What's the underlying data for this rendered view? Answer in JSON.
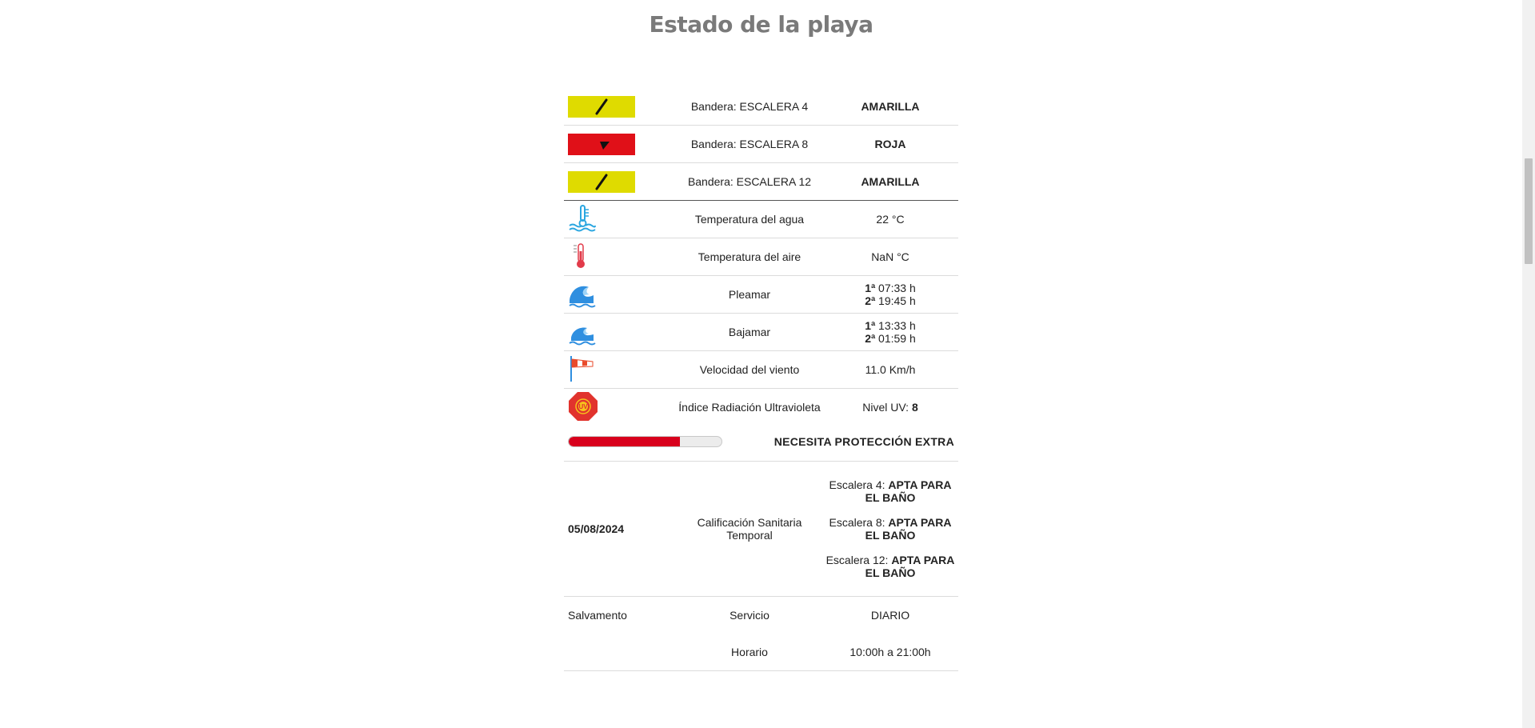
{
  "page": {
    "title": "Estado de la playa"
  },
  "flags": [
    {
      "label": "Bandera: ESCALERA 4",
      "value": "AMARILLA",
      "color": "#dfdb00",
      "icon": "yellow-flag-icon"
    },
    {
      "label": "Bandera: ESCALERA 8",
      "value": "ROJA",
      "color": "#e01018",
      "icon": "red-flag-icon"
    },
    {
      "label": "Bandera: ESCALERA 12",
      "value": "AMARILLA",
      "color": "#dfdb00",
      "icon": "yellow-flag-icon"
    }
  ],
  "water_temp": {
    "label": "Temperatura del agua",
    "value": "22 °C",
    "icon": "water-thermometer-icon"
  },
  "air_temp": {
    "label": "Temperatura del aire",
    "value": "NaN °C",
    "icon": "thermometer-icon"
  },
  "high_tide": {
    "label": "Pleamar",
    "icon": "wave-icon",
    "times": [
      {
        "n": "1ª",
        "t": " 07:33 h"
      },
      {
        "n": "2ª",
        "t": " 19:45 h"
      }
    ]
  },
  "low_tide": {
    "label": "Bajamar",
    "icon": "low-wave-icon",
    "times": [
      {
        "n": "1ª",
        "t": " 13:33 h"
      },
      {
        "n": "2ª",
        "t": " 01:59 h"
      }
    ]
  },
  "wind": {
    "label": "Velocidad del viento",
    "value": "11.0 Km/h",
    "icon": "windsock-icon"
  },
  "uv": {
    "label": "Índice Radiación Ultravioleta",
    "prefix": "Nivel UV: ",
    "level": "8",
    "icon": "uv-sun-icon",
    "message": "NECESITA PROTECCIÓN EXTRA",
    "fraction": 0.73,
    "bar_color": "#d8001c"
  },
  "sanitary": {
    "date": "05/08/2024",
    "label": "Calificación Sanitaria Temporal",
    "entries": [
      {
        "prefix": "Escalera 4: ",
        "status": "APTA PARA EL BAÑO"
      },
      {
        "prefix": "Escalera 8: ",
        "status": "APTA PARA EL BAÑO"
      },
      {
        "prefix": "Escalera 12: ",
        "status": "APTA PARA EL BAÑO"
      }
    ]
  },
  "lifeguard": {
    "title": "Salvamento",
    "service_label": "Servicio",
    "service_value": "DIARIO",
    "hours_label": "Horario",
    "hours_value": "10:00h a 21:00h"
  }
}
